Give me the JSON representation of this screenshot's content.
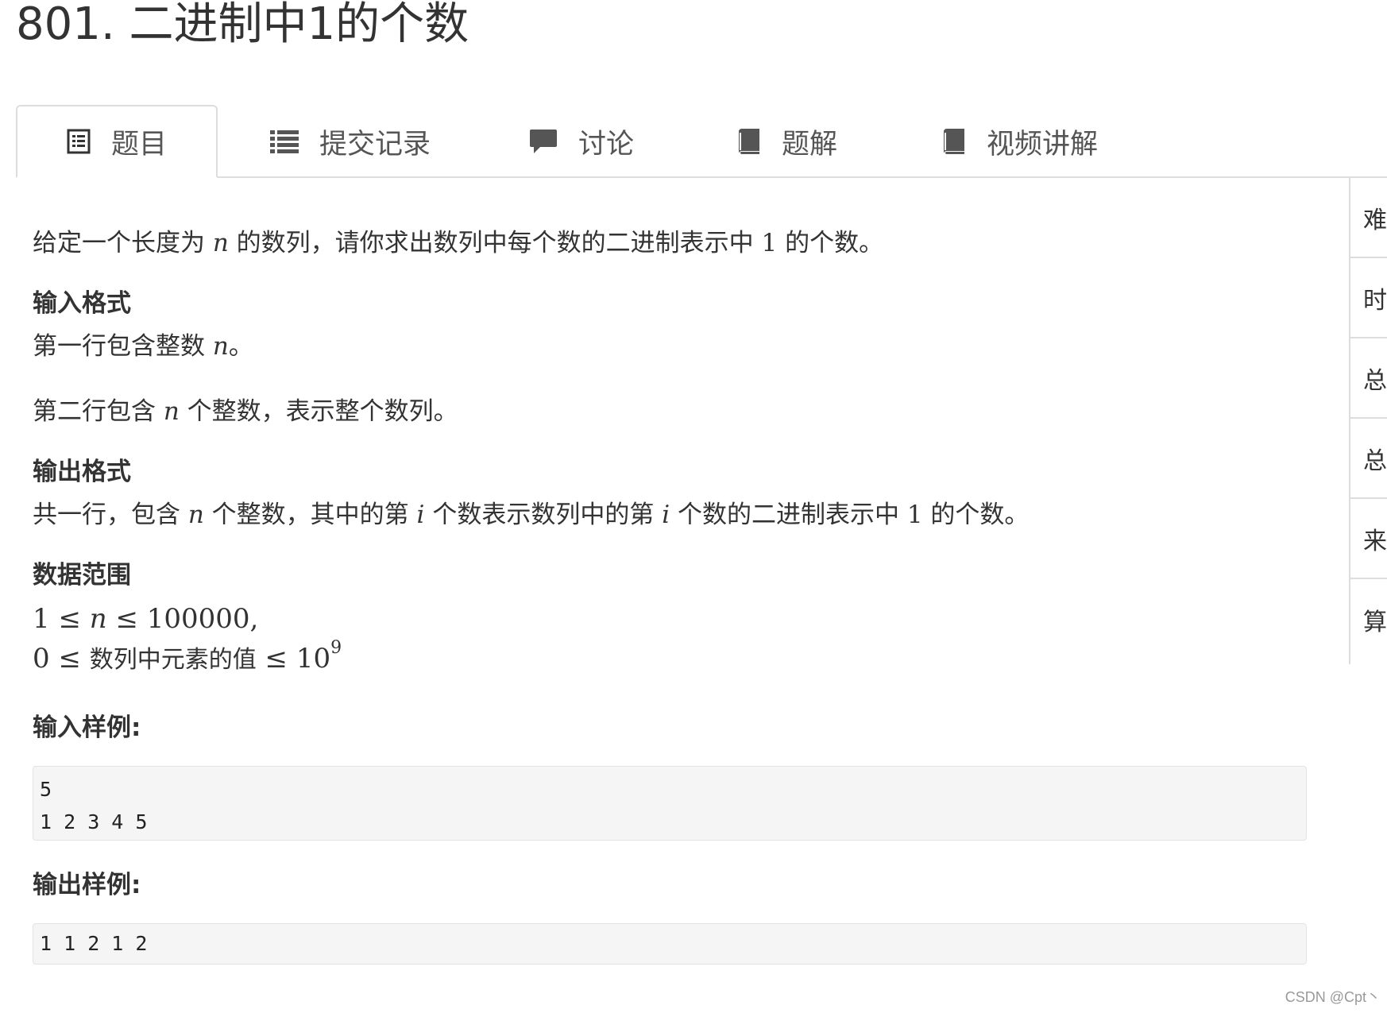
{
  "page": {
    "title": "801. 二进制中1的个数"
  },
  "tabs": [
    {
      "label": "题目",
      "icon": "list-alt-icon",
      "active": true
    },
    {
      "label": "提交记录",
      "icon": "list-icon",
      "active": false
    },
    {
      "label": "讨论",
      "icon": "comment-icon",
      "active": false
    },
    {
      "label": "题解",
      "icon": "book-icon",
      "active": false
    },
    {
      "label": "视频讲解",
      "icon": "book-icon",
      "active": false
    }
  ],
  "side_panel": {
    "rows": [
      "难度",
      "时/空限制",
      "总通过数",
      "总尝试数",
      "来源",
      "算法标签"
    ]
  },
  "problem": {
    "description_pre": "给定一个长度为 ",
    "var_n": "n",
    "description_mid": " 的数列，请你求出数列中每个数的二进制表示中 ",
    "one": "1",
    "description_post": " 的个数。",
    "input_heading": "输入格式",
    "input_line1_pre": "第一行包含整数 ",
    "input_line1_post": "。",
    "input_line2_pre": "第二行包含 ",
    "input_line2_post": " 个整数，表示整个数列。",
    "output_heading": "输出格式",
    "output_pre": "共一行，包含 ",
    "output_mid1": " 个整数，其中的第 ",
    "var_i": "i",
    "output_mid2": " 个数表示数列中的第 ",
    "output_mid3": " 个数的二进制表示中 ",
    "output_post": " 的个数。",
    "range_heading": "数据范围",
    "range_line1": "1 ≤ ",
    "range_line1_post": " ≤ 100000,",
    "range_line2_pre": "0 ≤ ",
    "range_line2_cjk": "数列中元素的值",
    "range_line2_post": " ≤ 10",
    "range_line2_exp": "9",
    "sample_in_heading": "输入样例:",
    "sample_in": "5\n1 2 3 4 5",
    "sample_out_heading": "输出样例:",
    "sample_out": "1 1 2 1 2"
  },
  "watermark": "CSDN @Cpt丶",
  "colors": {
    "text": "#333333",
    "border": "#dddddd",
    "code_bg": "#f5f5f5"
  }
}
